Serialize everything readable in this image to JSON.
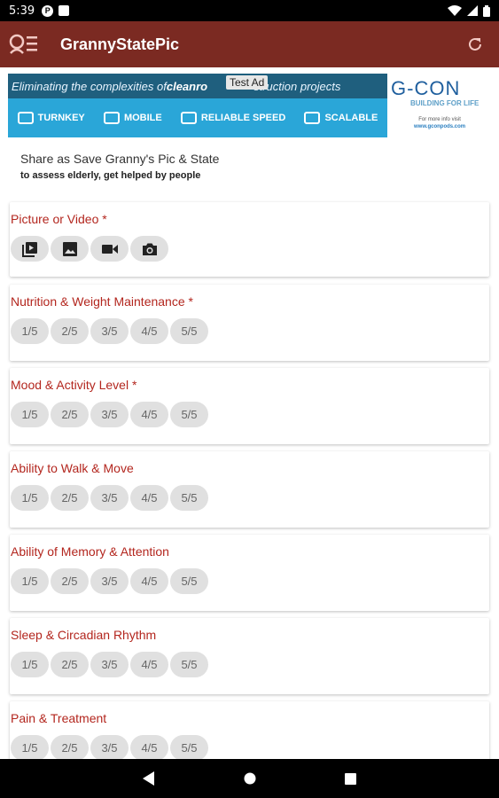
{
  "status_bar": {
    "time": "5:39",
    "app_icon": "P"
  },
  "app_bar": {
    "title": "GrannyStatePic"
  },
  "ad": {
    "tagline_start": "Eliminating the complexities of ",
    "tagline_bold": "cleanro",
    "tagline_end": "struction projects",
    "test_label": "Test Ad",
    "features": [
      "TURNKEY",
      "MOBILE",
      "RELIABLE SPEED",
      "SCALABLE"
    ],
    "brand": "G-CON",
    "brand_sub": "BUILDING FOR LIFE",
    "visit_line1": "For more info visit",
    "visit_url": "www.gconpods.com"
  },
  "intro": {
    "line1": "Share as Save Granny's Pic & State",
    "line2": "to assess elderly, get helped by people"
  },
  "media_section": {
    "label": "Picture or Video *",
    "buttons": [
      "video-library-icon",
      "image-icon",
      "videocam-icon",
      "camera-icon"
    ]
  },
  "rating_sections": [
    {
      "label": "Nutrition & Weight Maintenance *",
      "options": [
        "1/5",
        "2/5",
        "3/5",
        "4/5",
        "5/5"
      ]
    },
    {
      "label": "Mood & Activity Level *",
      "options": [
        "1/5",
        "2/5",
        "3/5",
        "4/5",
        "5/5"
      ]
    },
    {
      "label": "Ability to Walk & Move",
      "options": [
        "1/5",
        "2/5",
        "3/5",
        "4/5",
        "5/5"
      ]
    },
    {
      "label": "Ability of Memory & Attention",
      "options": [
        "1/5",
        "2/5",
        "3/5",
        "4/5",
        "5/5"
      ]
    },
    {
      "label": "Sleep & Circadian Rhythm",
      "options": [
        "1/5",
        "2/5",
        "3/5",
        "4/5",
        "5/5"
      ]
    },
    {
      "label": "Pain & Treatment",
      "options": [
        "1/5",
        "2/5",
        "3/5",
        "4/5",
        "5/5"
      ]
    }
  ],
  "colors": {
    "app_bar": "#7b2a22",
    "label": "#b3261e",
    "chip": "#e0e0e0"
  }
}
